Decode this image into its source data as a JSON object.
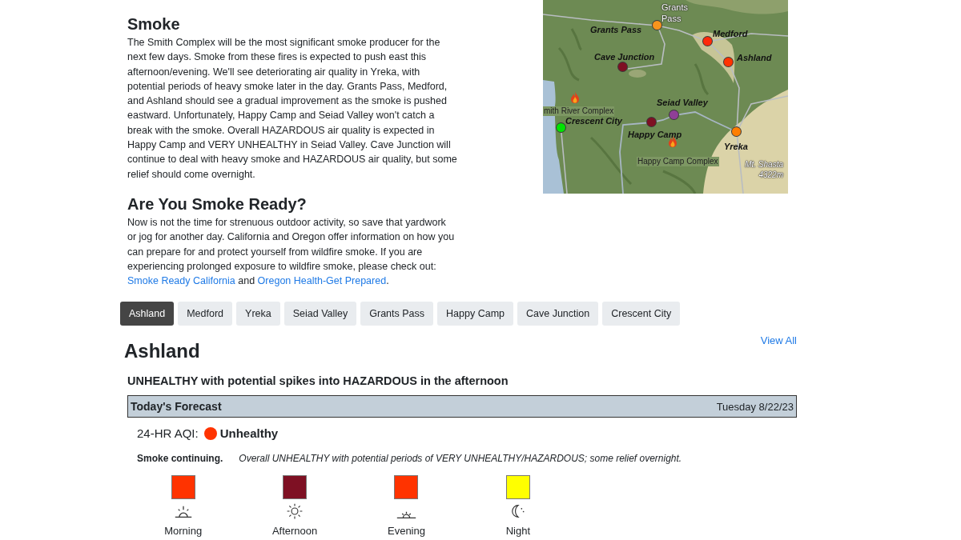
{
  "smoke": {
    "heading": "Smoke",
    "text": "The Smith Complex will be the most significant smoke producer for the next few days. Smoke from these fires is expected to push east this afternoon/evening. We'll see deteriorating air quality in Yreka, with potential periods of heavy smoke later in the day. Grants Pass, Medford, and Ashland should see a gradual improvement as the smoke is pushed eastward. Unfortunately, Happy Camp and Seiad Valley won't catch a break with the smoke. Overall HAZARDOUS air quality is expected in Happy Camp and VERY UNHEALTHY in Seiad Valley. Cave Junction will continue to deal with heavy smoke and HAZARDOUS air quality, but some relief should come overnight."
  },
  "map": {
    "place_labels": [
      "Grants Pass",
      "Mt. Shasta 4322m"
    ],
    "markers": [
      {
        "name": "Grants Pass",
        "color": "#f7941d"
      },
      {
        "name": "Medford",
        "color": "#ff2a0a"
      },
      {
        "name": "Ashland",
        "color": "#ff3300"
      },
      {
        "name": "Cave Junction",
        "color": "#7e1023"
      },
      {
        "name": "Seiad Valley",
        "color": "#8f3f97"
      },
      {
        "name": "Crescent City",
        "color": "#00e400"
      },
      {
        "name": "Happy Camp",
        "color": "#7e1023"
      },
      {
        "name": "Yreka",
        "color": "#ff7e00"
      }
    ],
    "fires": [
      {
        "name": "mith River Complex"
      },
      {
        "name": "Happy Camp Complex"
      }
    ]
  },
  "ready": {
    "heading": "Are You Smoke Ready?",
    "segments": [
      {
        "kind": "text",
        "text": "Now is not the time for strenuous outdoor activity, so save that yardwork or jog for another day. California and Oregon offer information on how you can prepare for and protect yourself from wildfire smoke. If you are experiencing prolonged exposure to wildfire smoke, please check out: "
      },
      {
        "kind": "link",
        "text": "Smoke Ready California"
      },
      {
        "kind": "text",
        "text": " and "
      },
      {
        "kind": "link",
        "text": "Oregon Health-Get Prepared"
      },
      {
        "kind": "text",
        "text": "."
      }
    ]
  },
  "tabs": [
    {
      "label": "Ashland",
      "selected": true
    },
    {
      "label": "Medford",
      "selected": false
    },
    {
      "label": "Yreka",
      "selected": false
    },
    {
      "label": "Seiad Valley",
      "selected": false
    },
    {
      "label": "Grants Pass",
      "selected": false
    },
    {
      "label": "Happy Camp",
      "selected": false
    },
    {
      "label": "Cave Junction",
      "selected": false
    },
    {
      "label": "Crescent City",
      "selected": false
    }
  ],
  "location": {
    "title": "Ashland",
    "view_all": "View All",
    "summary": "UNHEALTHY with potential spikes into HAZARDOUS in the afternoon",
    "forecast": {
      "title": "Today's Forecast",
      "date": "Tuesday 8/22/23",
      "aqi": {
        "label": "24-HR AQI:",
        "color": "#ff3300",
        "category": "Unhealthy"
      },
      "note_title": "Smoke continuing.",
      "note_text": "Overall UNHEALTHY with potential periods of VERY UNHEALTHY/HAZARDOUS; some relief overnight.",
      "periods": [
        {
          "label": "Morning",
          "color": "#ff3300"
        },
        {
          "label": "Afternoon",
          "color": "#7e1023"
        },
        {
          "label": "Evening",
          "color": "#ff3300"
        },
        {
          "label": "Night",
          "color": "#ffff00"
        }
      ]
    }
  }
}
